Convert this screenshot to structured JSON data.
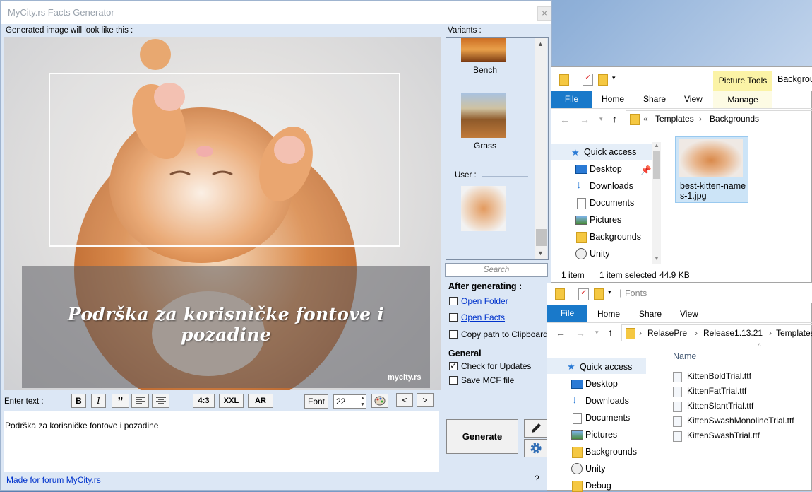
{
  "gen": {
    "title": "MyCity.rs Facts Generator",
    "close": "×",
    "preview_label": "Generated image will look like this :",
    "caption": "Podrška za korisničke fontove i pozadine",
    "watermark": "mycity.rs",
    "variants_label": "Variants :",
    "variants": [
      {
        "label": "Bench"
      },
      {
        "label": "Grass"
      }
    ],
    "user_label": "User :",
    "search_placeholder": "Search",
    "after_generating": "After generating :",
    "open_folder": "Open Folder",
    "open_facts": "Open Facts",
    "copy_path": "Copy path to Clipboard",
    "general": "General",
    "check_updates": "Check for Updates",
    "check_updates_checked": true,
    "save_mcf": "Save MCF file",
    "enter_text": "Enter text :",
    "toolbar": {
      "bold": "B",
      "italic": "I",
      "quote": "”",
      "r43": "4:3",
      "xxl": "XXL",
      "ar": "AR",
      "font": "Font",
      "font_size": "22",
      "prev": "<",
      "next": ">"
    },
    "text_value": "Podrška za korisničke fontove i pozadine",
    "generate": "Generate",
    "footer_link": "Made for forum MyCity.rs",
    "help": "?"
  },
  "explorer1": {
    "picture_tools": "Picture Tools",
    "title_partial": "Backgrou",
    "tabs": [
      "File",
      "Home",
      "Share",
      "View",
      "Manage"
    ],
    "path": [
      "«",
      "Templates",
      "›",
      "Backgrounds"
    ],
    "nav": [
      {
        "label": "Quick access"
      },
      {
        "label": "Desktop"
      },
      {
        "label": "Downloads"
      },
      {
        "label": "Documents"
      },
      {
        "label": "Pictures"
      },
      {
        "label": "Backgrounds"
      },
      {
        "label": "Unity"
      }
    ],
    "file_name": "best-kitten-names-1.jpg",
    "file_name_line1": "best-kitten-name",
    "file_name_line2": "s-1.jpg",
    "status_items": "1 item",
    "status_selected": "1 item selected",
    "status_size": "44.9 KB"
  },
  "explorer2": {
    "title": "Fonts",
    "tabs": [
      "File",
      "Home",
      "Share",
      "View"
    ],
    "path": [
      "RelasePre",
      "Release1.13.21",
      "Templates"
    ],
    "nav": [
      {
        "label": "Quick access"
      },
      {
        "label": "Desktop"
      },
      {
        "label": "Downloads"
      },
      {
        "label": "Documents"
      },
      {
        "label": "Pictures"
      },
      {
        "label": "Backgrounds"
      },
      {
        "label": "Unity"
      },
      {
        "label": "Debug"
      }
    ],
    "column_name": "Name",
    "files": [
      "KittenBoldTrial.ttf",
      "KittenFatTrial.ttf",
      "KittenSlantTrial.ttf",
      "KittenSwashMonolineTrial.ttf",
      "KittenSwashTrial.ttf"
    ]
  }
}
